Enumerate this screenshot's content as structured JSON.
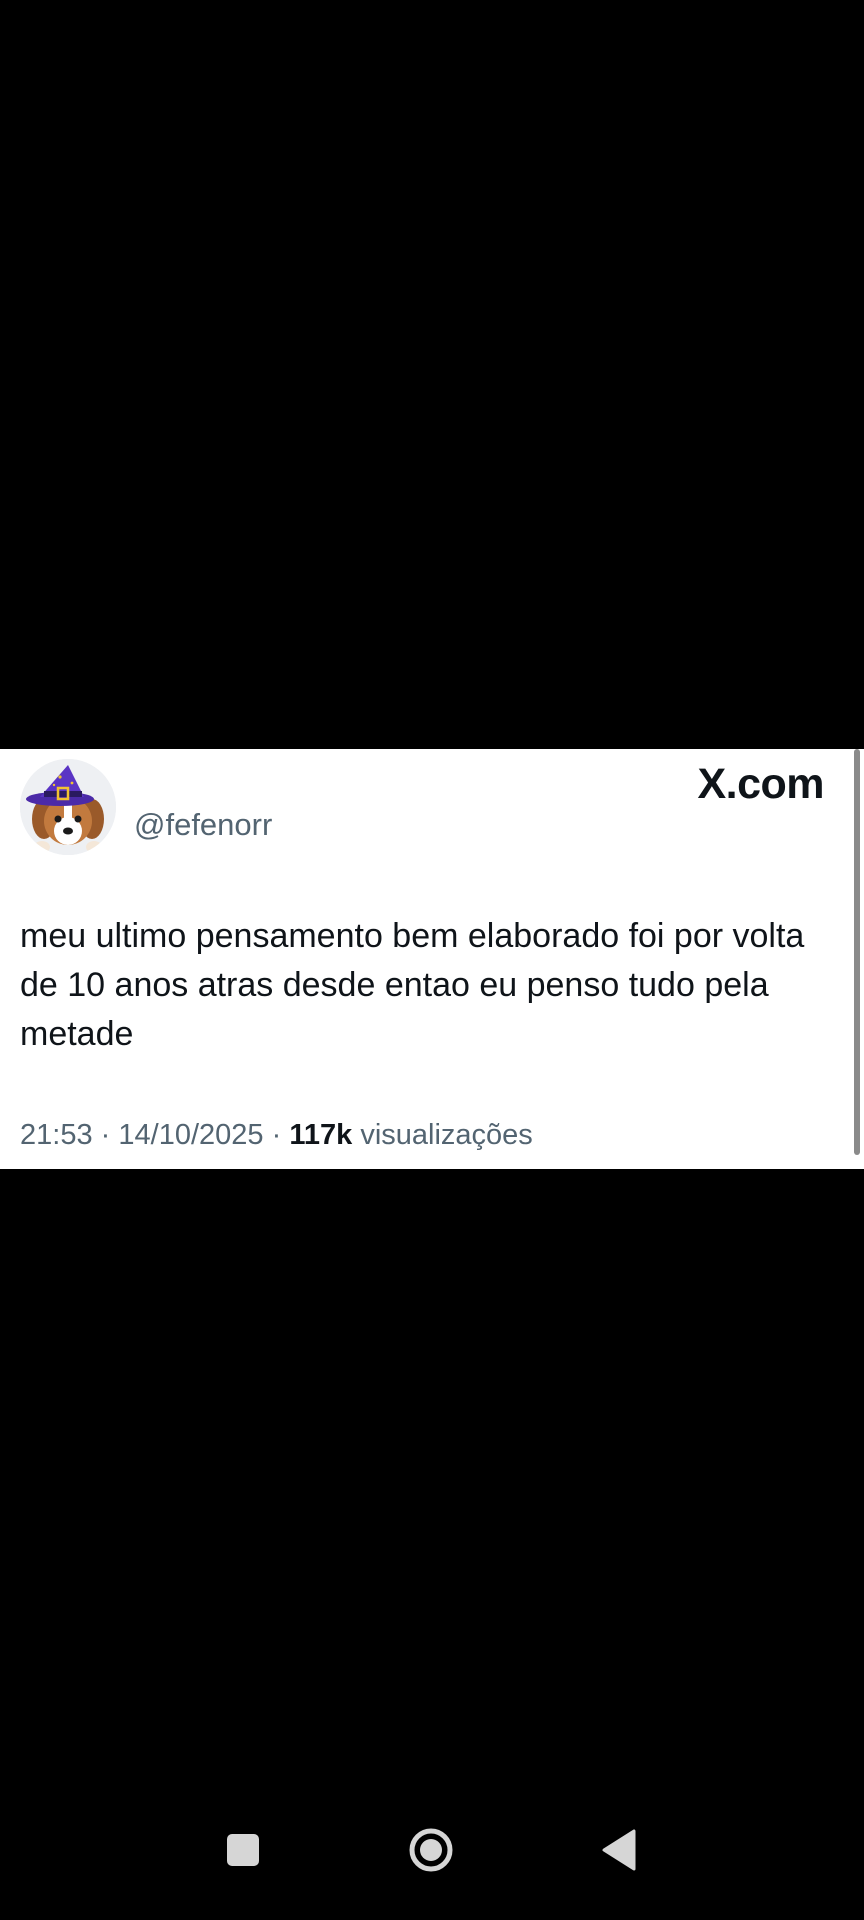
{
  "tweet": {
    "handle": "@fefenorr",
    "brand": "X.com",
    "text": "meu ultimo pensamento bem elaborado foi por volta de 10 anos atras desde entao eu penso tudo pela metade",
    "time": "21:53",
    "separator": "·",
    "date": "14/10/2025",
    "views_count": "117k",
    "views_label": "visualizações",
    "avatar_icon": "puppy-wizard-hat-avatar"
  },
  "nav": {
    "recents_icon": "square-icon",
    "home_icon": "circle-home-icon",
    "back_icon": "triangle-back-icon"
  },
  "colors": {
    "background": "#000000",
    "card": "#ffffff",
    "text": "#0f1419",
    "secondary": "#536471"
  }
}
